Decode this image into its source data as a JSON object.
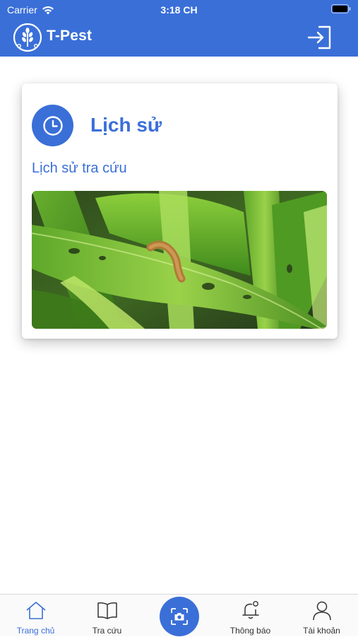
{
  "status_bar": {
    "carrier": "Carrier",
    "time": "3:18 CH"
  },
  "app_bar": {
    "title": "T-Pest",
    "logo_icon": "wheat-logo-icon",
    "action_icon": "logout-icon"
  },
  "card": {
    "icon": "clock-icon",
    "title": "Lịch sử",
    "subtitle": "Lịch sử tra cứu",
    "image_alt": "caterpillar-on-corn-leaf-photo"
  },
  "tabs": [
    {
      "label": "Trang chủ",
      "icon": "home-icon",
      "active": true
    },
    {
      "label": "Tra cứu",
      "icon": "book-icon",
      "active": false
    },
    {
      "label": "",
      "icon": "camera-scan-icon",
      "active": false
    },
    {
      "label": "Thông báo",
      "icon": "bell-icon",
      "active": false
    },
    {
      "label": "Tài khoản",
      "icon": "user-icon",
      "active": false
    }
  ],
  "colors": {
    "primary": "#3a6fd8",
    "background": "#ffffff",
    "tab_inactive": "#333333"
  }
}
